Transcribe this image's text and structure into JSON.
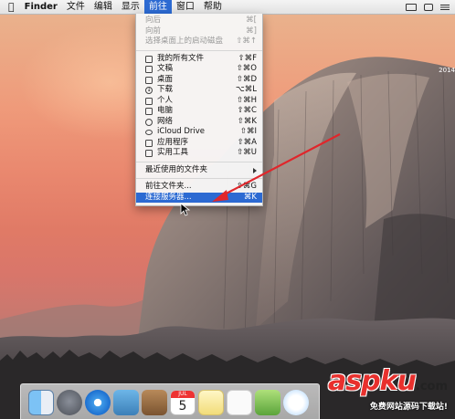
{
  "menubar": {
    "app_name": "Finder",
    "items": [
      "文件",
      "编辑",
      "显示",
      "前往",
      "窗口",
      "帮助"
    ],
    "active_item": "前往"
  },
  "go_menu": {
    "back": {
      "label": "向后",
      "shortcut": "⌘["
    },
    "forward": {
      "label": "向前",
      "shortcut": "⌘]"
    },
    "startup_disk": {
      "label": "选择桌面上的启动磁盘",
      "shortcut": "⇧⌘↑"
    },
    "places": [
      {
        "label": "我的所有文件",
        "shortcut": "⇧⌘F",
        "icon": "all-files-icon"
      },
      {
        "label": "文稿",
        "shortcut": "⇧⌘O",
        "icon": "documents-icon"
      },
      {
        "label": "桌面",
        "shortcut": "⇧⌘D",
        "icon": "desktop-icon"
      },
      {
        "label": "下载",
        "shortcut": "⌥⌘L",
        "icon": "downloads-icon"
      },
      {
        "label": "个人",
        "shortcut": "⇧⌘H",
        "icon": "home-icon"
      },
      {
        "label": "电脑",
        "shortcut": "⇧⌘C",
        "icon": "computer-icon"
      },
      {
        "label": "网络",
        "shortcut": "⇧⌘K",
        "icon": "network-icon"
      },
      {
        "label": "iCloud Drive",
        "shortcut": "⇧⌘I",
        "icon": "icloud-icon"
      },
      {
        "label": "应用程序",
        "shortcut": "⇧⌘A",
        "icon": "applications-icon"
      },
      {
        "label": "实用工具",
        "shortcut": "⇧⌘U",
        "icon": "utilities-icon"
      }
    ],
    "recent_folders": {
      "label": "最近使用的文件夹"
    },
    "go_to_folder": {
      "label": "前往文件夹...",
      "shortcut": "⇧⌘G"
    },
    "connect_server": {
      "label": "连接服务器...",
      "shortcut": "⌘K"
    }
  },
  "desktop": {
    "year_label": "2014"
  },
  "dock": {
    "calendar_month": "JUL",
    "calendar_day": "5"
  },
  "watermark": {
    "logo": "aspku",
    "logo_suffix": ".com",
    "subtitle": "免费网站源码下载站!"
  },
  "colors": {
    "menu_highlight": "#2c6ad2",
    "annotation_arrow": "#e0262b",
    "watermark_red": "#e8302d"
  }
}
